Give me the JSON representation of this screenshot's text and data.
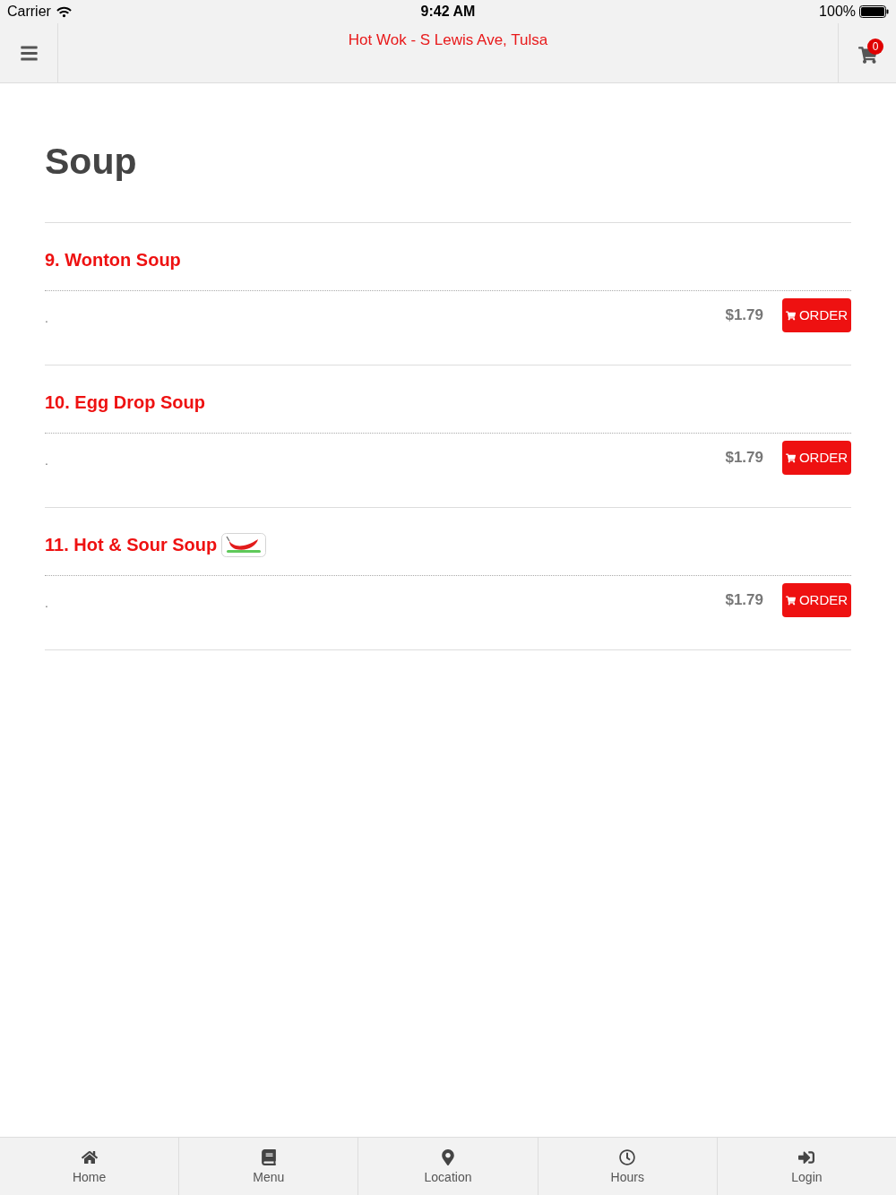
{
  "status_bar": {
    "carrier": "Carrier",
    "time": "9:42 AM",
    "battery": "100%"
  },
  "header": {
    "title": "Hot Wok - S Lewis Ave, Tulsa",
    "cart_count": "0"
  },
  "section": {
    "title": "Soup"
  },
  "items": [
    {
      "name": "9. Wonton Soup",
      "spicy": false,
      "description": ".",
      "price": "$1.79",
      "button": "ORDER"
    },
    {
      "name": "10. Egg Drop Soup",
      "spicy": false,
      "description": ".",
      "price": "$1.79",
      "button": "ORDER"
    },
    {
      "name": "11. Hot & Sour Soup",
      "spicy": true,
      "description": ".",
      "price": "$1.79",
      "button": "ORDER"
    }
  ],
  "tab_bar": [
    {
      "label": "Home",
      "kind": "home"
    },
    {
      "label": "Menu",
      "kind": "menu"
    },
    {
      "label": "Location",
      "kind": "location"
    },
    {
      "label": "Hours",
      "kind": "hours"
    },
    {
      "label": "Login",
      "kind": "login"
    }
  ]
}
